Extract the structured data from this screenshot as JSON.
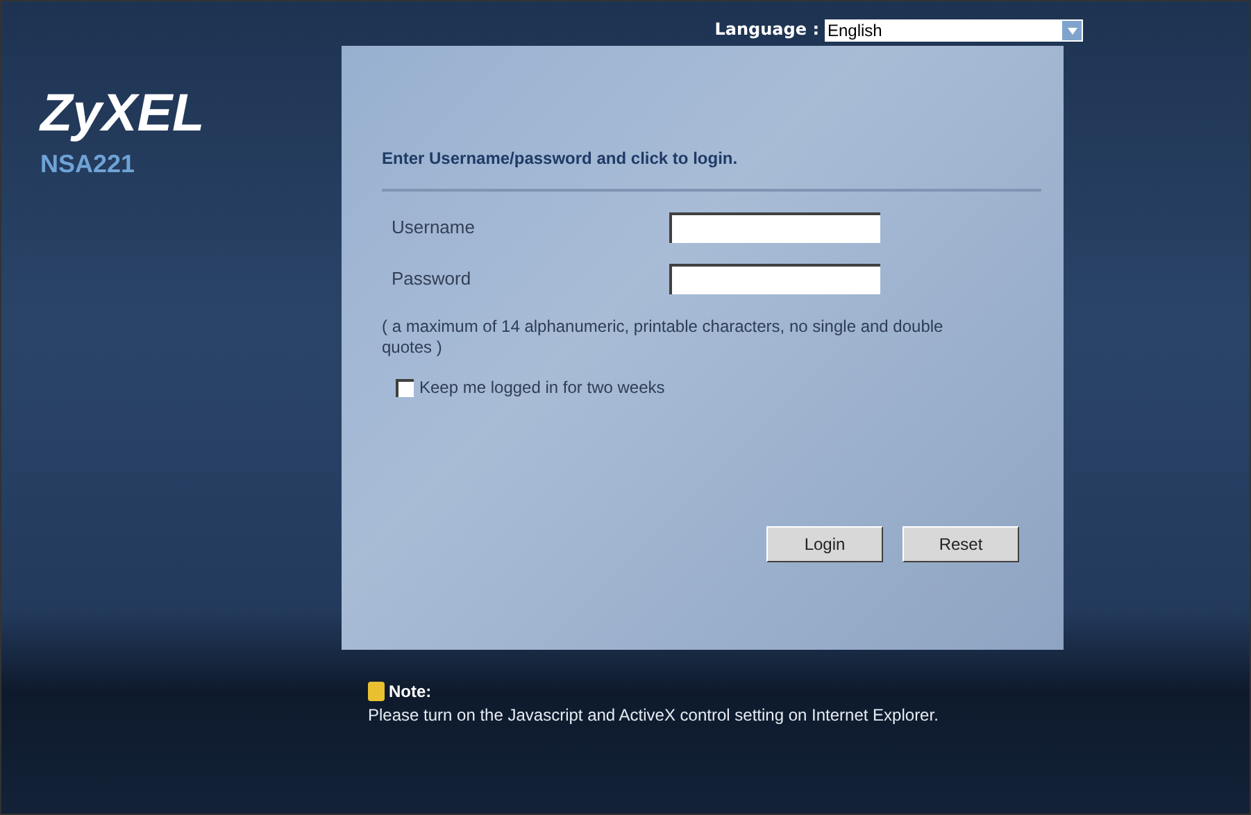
{
  "logo": {
    "brand": "ZyXEL",
    "model": "NSA221"
  },
  "language": {
    "label": "Language :",
    "value": "English"
  },
  "login": {
    "heading": "Enter Username/password and click to login.",
    "fields": [
      {
        "label": "Username"
      },
      {
        "label": "Password"
      }
    ],
    "hint": "( a maximum of 14 alphanumeric, printable characters, no single and double quotes )",
    "remember": {
      "label": "Keep me logged in for two weeks",
      "checked": false
    },
    "buttons": [
      "Login",
      "Reset"
    ]
  },
  "note": {
    "title": "Note:",
    "text": "Please turn on the Javascript and ActiveX control setting on Internet Explorer."
  }
}
